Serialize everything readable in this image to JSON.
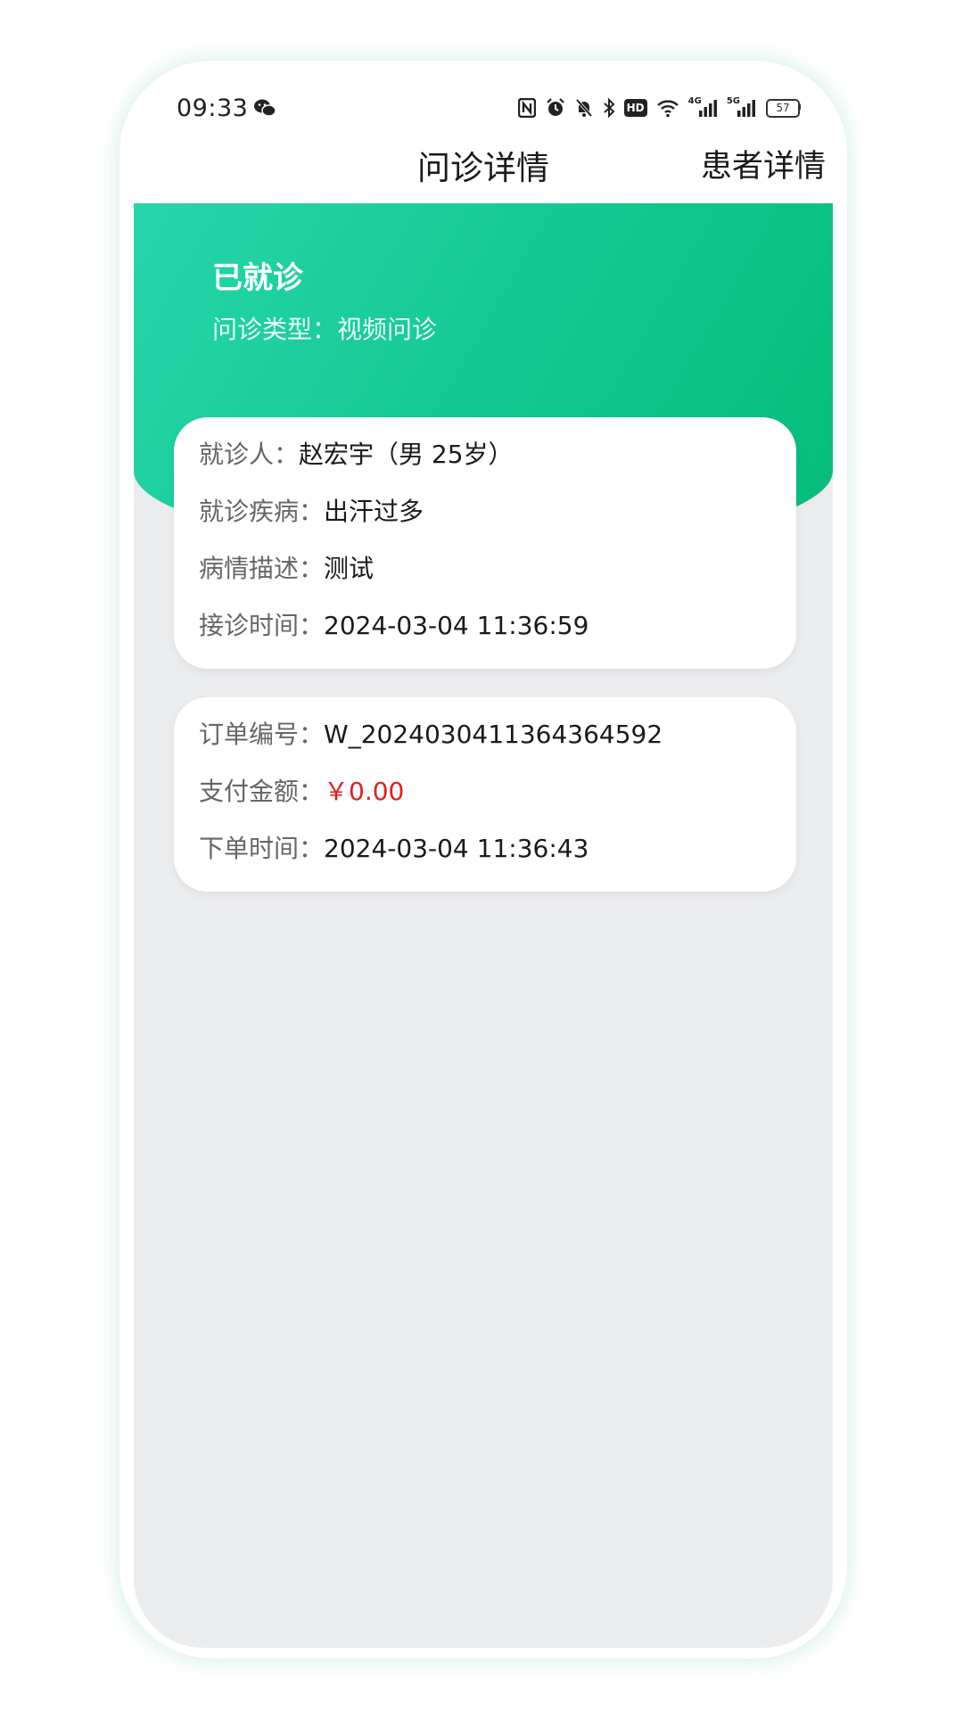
{
  "status_bar": {
    "time": "09:33",
    "battery": "57",
    "network_4g": "4G",
    "network_5g": "5G",
    "hd_badge": "HD"
  },
  "nav": {
    "title": "问诊详情",
    "action": "患者详情"
  },
  "hero": {
    "status": "已就诊",
    "consult_type": "问诊类型：视频问诊"
  },
  "patient_card": {
    "patient_label": "就诊人：",
    "patient_value": "赵宏宇（男 25岁）",
    "disease_label": "就诊疾病：",
    "disease_value": "出汗过多",
    "desc_label": "病情描述：",
    "desc_value": "测试",
    "accept_label": "接诊时间：",
    "accept_value": "2024-03-04 11:36:59"
  },
  "order_card": {
    "order_no_label": "订单编号：",
    "order_no_value": "W_2024030411364364592",
    "amount_label": "支付金额：",
    "amount_value": "￥0.00",
    "order_time_label": "下单时间：",
    "order_time_value": "2024-03-04 11:36:43"
  },
  "colors": {
    "brand_green": "#12c78f",
    "price_red": "#e02020",
    "background": "#ebecee"
  }
}
